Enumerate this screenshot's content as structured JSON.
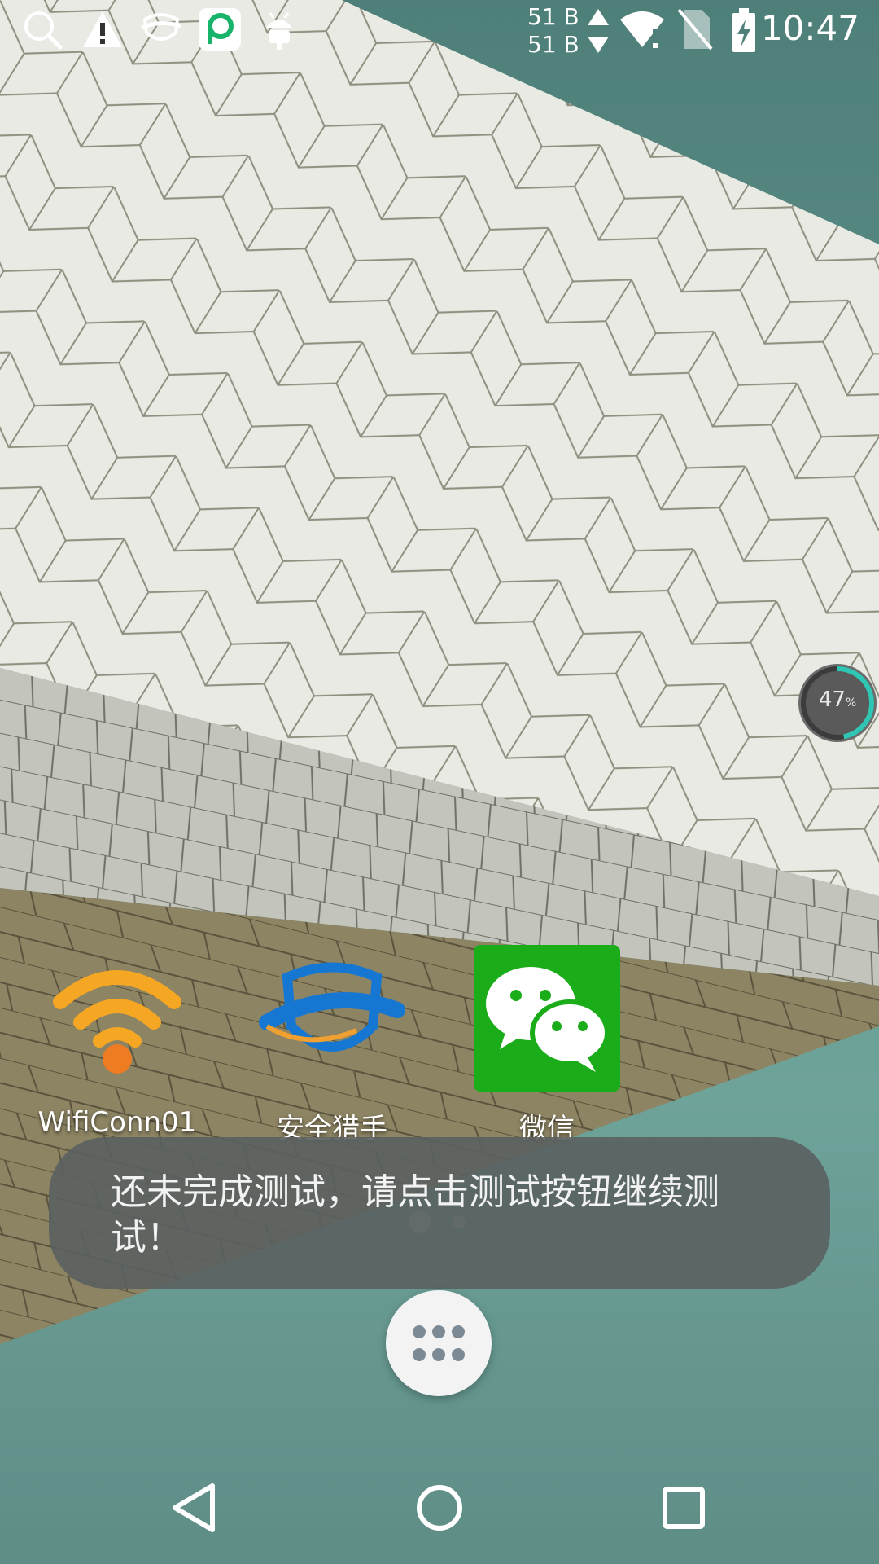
{
  "status_bar": {
    "net_up": "51 B",
    "net_down": "51 B",
    "time": "10:47",
    "icons": [
      "search-icon",
      "warning-icon",
      "security-app-icon",
      "p-app-icon",
      "android-icon",
      "wifi-icon",
      "no-sim-icon",
      "battery-charging-icon"
    ]
  },
  "battery_widget": {
    "value": "47",
    "unit": "%",
    "fraction": 0.47
  },
  "apps": [
    {
      "label": "WifiConn01",
      "icon": "wifi-app-icon"
    },
    {
      "label": "安全猎手",
      "icon": "security-hunter-icon"
    },
    {
      "label": "微信",
      "icon": "wechat-icon"
    }
  ],
  "toast": {
    "message": "还未完成测试，请点击测试按钮继续测试！"
  },
  "pager": {
    "pages": 2,
    "current": 1
  },
  "nav": {
    "icons": [
      "back-icon",
      "home-icon",
      "recents-icon"
    ]
  },
  "colors": {
    "accent_teal": "#2fc7b3",
    "wechat_green": "#1aad19",
    "wifi_orange": "#f5a623"
  }
}
